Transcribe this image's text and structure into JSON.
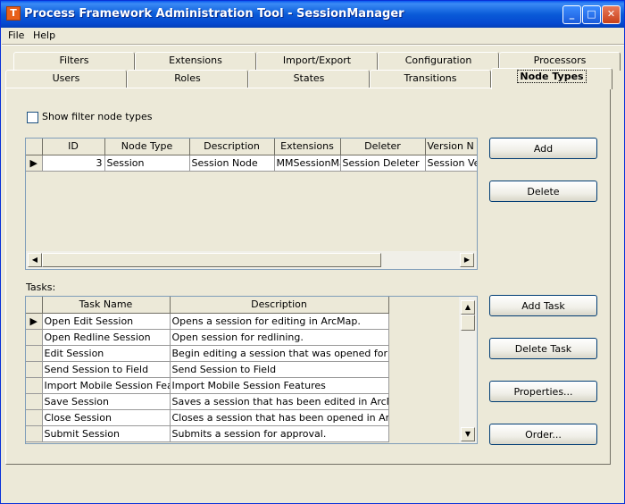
{
  "window": {
    "title": "Process Framework Administration Tool - SessionManager",
    "icon_letter": "T",
    "minimize": "_",
    "maximize": "□",
    "close": "✕"
  },
  "menu": {
    "file": "File",
    "help": "Help"
  },
  "tabs_row1": [
    "Filters",
    "Extensions",
    "Import/Export",
    "Configuration",
    "Processors"
  ],
  "tabs_row2": [
    "Users",
    "Roles",
    "States",
    "Transitions",
    "Node Types"
  ],
  "active_tab": "Node Types",
  "filter": {
    "label": "Show filter node types",
    "checked": false
  },
  "node_grid": {
    "columns": [
      "ID",
      "Node Type",
      "Description",
      "Extensions",
      "Deleter",
      "Version N"
    ],
    "rows": [
      {
        "indicator": "▶",
        "cells": [
          "3",
          "Session",
          "Session Node",
          "MMSessionMa",
          "Session Deleter",
          "Session Ve"
        ]
      }
    ]
  },
  "buttons": {
    "add": "Add",
    "delete": "Delete",
    "add_task": "Add Task",
    "delete_task": "Delete Task",
    "properties": "Properties...",
    "order": "Order..."
  },
  "tasks": {
    "label": "Tasks:",
    "columns": [
      "Task Name",
      "Description"
    ],
    "rows": [
      {
        "indicator": "▶",
        "name": "Open Edit Session",
        "desc": "Opens a session for editing in ArcMap."
      },
      {
        "indicator": "",
        "name": "Open Redline Session",
        "desc": "Open session for redlining."
      },
      {
        "indicator": "",
        "name": "Edit Session",
        "desc": "Begin editing a session that was opened for redlini"
      },
      {
        "indicator": "",
        "name": "Send Session to Field",
        "desc": "Send Session to Field"
      },
      {
        "indicator": "",
        "name": "Import Mobile Session Featur",
        "desc": "Import Mobile Session Features"
      },
      {
        "indicator": "",
        "name": "Save Session",
        "desc": "Saves a session that has been edited in ArcMap."
      },
      {
        "indicator": "",
        "name": "Close Session",
        "desc": "Closes a session that has been opened in ArcMap"
      },
      {
        "indicator": "",
        "name": "Submit Session",
        "desc": "Submits a session for approval."
      }
    ]
  },
  "scroll": {
    "left": "◀",
    "right": "▶",
    "up": "▲",
    "down": "▼"
  }
}
